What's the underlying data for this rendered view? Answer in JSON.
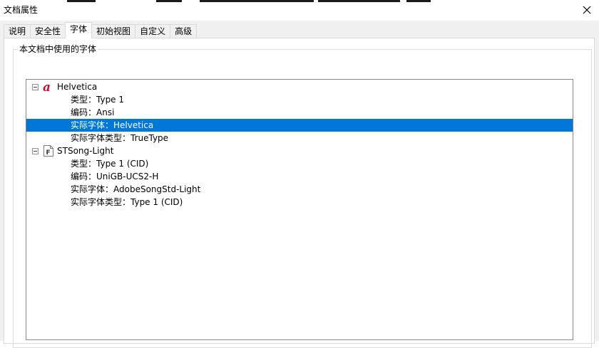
{
  "window": {
    "title": "文档属性",
    "close_icon": "close-icon"
  },
  "tabs": [
    {
      "label": "说明",
      "active": false
    },
    {
      "label": "安全性",
      "active": false
    },
    {
      "label": "字体",
      "active": true
    },
    {
      "label": "初始视图",
      "active": false
    },
    {
      "label": "自定义",
      "active": false
    },
    {
      "label": "高级",
      "active": false
    }
  ],
  "group": {
    "title": "本文档中使用的字体"
  },
  "fonts": [
    {
      "name": "Helvetica",
      "icon": "type1-font-icon",
      "expanded": true,
      "properties": [
        {
          "label": "类型",
          "value": "Type 1",
          "text": "类型：Type 1"
        },
        {
          "label": "编码",
          "value": "Ansi",
          "text": "编码：Ansi"
        },
        {
          "label": "实际字体",
          "value": "Helvetica",
          "text": "实际字体：Helvetica",
          "selected": true
        },
        {
          "label": "实际字体类型",
          "value": "TrueType",
          "text": "实际字体类型：TrueType"
        }
      ]
    },
    {
      "name": "STSong-Light",
      "icon": "generic-font-icon",
      "expanded": true,
      "properties": [
        {
          "label": "类型",
          "value": "Type 1 (CID)",
          "text": "类型：Type 1 (CID)"
        },
        {
          "label": "编码",
          "value": "UniGB-UCS2-H",
          "text": "编码：UniGB-UCS2-H"
        },
        {
          "label": "实际字体",
          "value": "AdobeSongStd-Light",
          "text": "实际字体：AdobeSongStd-Light"
        },
        {
          "label": "实际字体类型",
          "value": "Type 1 (CID)",
          "text": "实际字体类型：Type 1 (CID)"
        }
      ]
    }
  ],
  "colors": {
    "selection": "#0078d7",
    "type1_icon_red": "#c8102e"
  }
}
